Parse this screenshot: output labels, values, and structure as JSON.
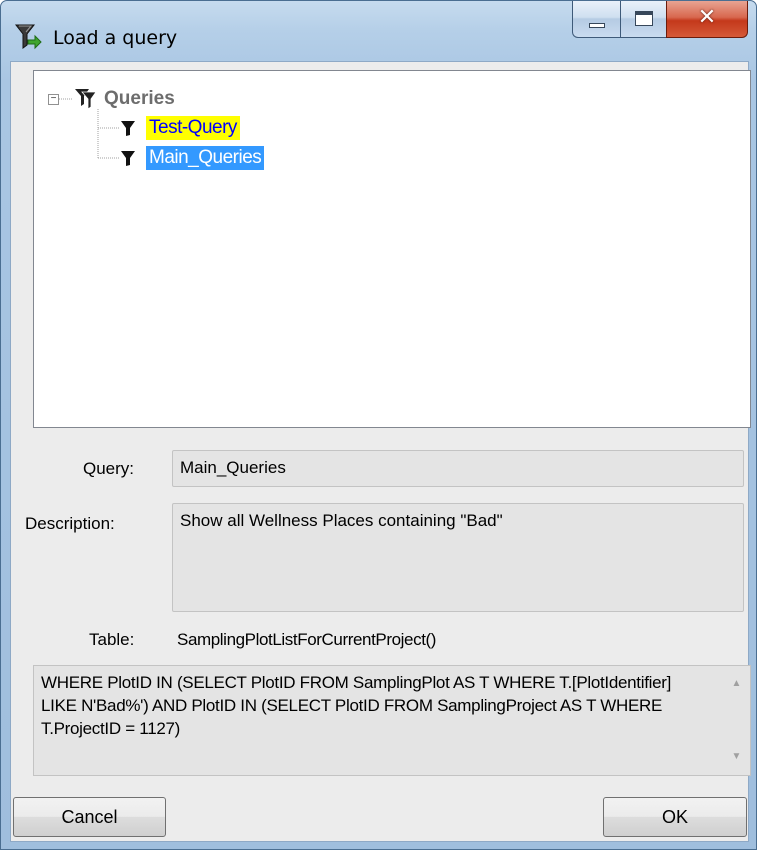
{
  "window": {
    "title": "Load a query"
  },
  "tree": {
    "root": {
      "label": "Queries",
      "expander": "⊟"
    },
    "items": [
      {
        "label": "Test-Query",
        "highlight": "yellow"
      },
      {
        "label": "Main_Queries",
        "highlight": "selected"
      }
    ]
  },
  "fields": {
    "query_label": "Query:",
    "query_value": "Main_Queries",
    "description_label": "Description:",
    "description_value": "Show all Wellness Places containing \"Bad\"",
    "table_label": "Table:",
    "table_value": "SamplingPlotListForCurrentProject()"
  },
  "sql": {
    "text": " WHERE PlotID IN (SELECT PlotID FROM SamplingPlot AS T  WHERE T.[PlotIdentifier] LIKE N'Bad%') AND PlotID IN (SELECT PlotID FROM SamplingProject AS T  WHERE T.ProjectID = 1127)"
  },
  "buttons": {
    "cancel": "Cancel",
    "ok": "OK"
  },
  "colors": {
    "highlight_yellow": "#ffff00",
    "selected_blue": "#3399ff",
    "window_frame": "#b5cfe8"
  }
}
